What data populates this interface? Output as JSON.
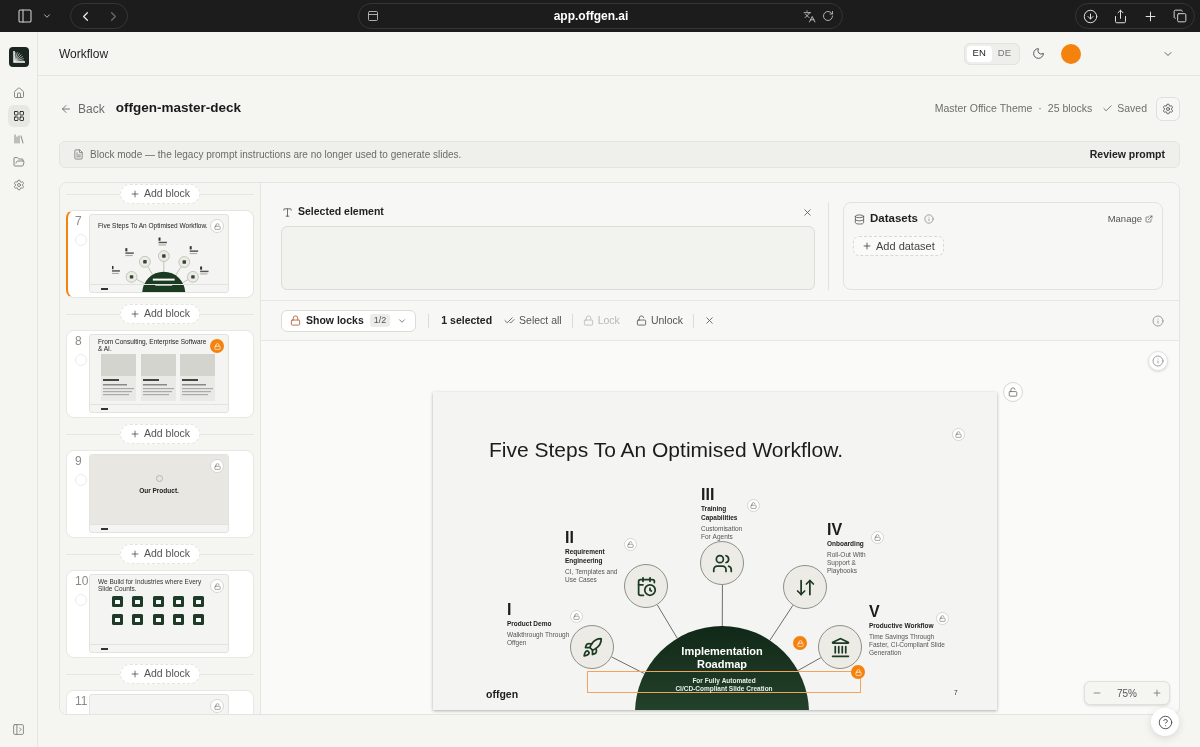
{
  "browser": {
    "url": "app.offgen.ai"
  },
  "rail": {
    "items": [
      {
        "selected": false
      },
      {
        "selected": true
      },
      {
        "selected": false
      },
      {
        "selected": false
      },
      {
        "selected": false
      }
    ]
  },
  "header": {
    "title": "Workflow",
    "languages": [
      {
        "label": "EN",
        "selected": true
      },
      {
        "label": "DE",
        "selected": false
      }
    ]
  },
  "deck": {
    "back": "Back",
    "name": "offgen-master-deck",
    "theme": "Master Office Theme",
    "separator": "·",
    "count": "25 blocks",
    "status": "Saved"
  },
  "notice": {
    "text": "Block mode — the legacy prompt instructions are no longer used to generate slides.",
    "action": "Review prompt"
  },
  "blocks": {
    "items": [
      {
        "kind": "add",
        "label": "Add block"
      },
      {
        "kind": "slide",
        "number": "7",
        "selected": true,
        "checked": false,
        "locked": false,
        "thumbnail": {
          "kind": "diagram",
          "title": "Five Steps To An Optimised Workflow."
        }
      },
      {
        "kind": "add",
        "label": "Add block"
      },
      {
        "kind": "slide",
        "number": "8",
        "selected": false,
        "checked": false,
        "locked": true,
        "thumbnail": {
          "kind": "team",
          "title": "From Consulting, Enterprise Software & AI."
        }
      },
      {
        "kind": "add",
        "label": "Add block"
      },
      {
        "kind": "slide",
        "number": "9",
        "selected": false,
        "checked": false,
        "locked": false,
        "thumbnail": {
          "kind": "section",
          "title": "Our Product."
        }
      },
      {
        "kind": "add",
        "label": "Add block"
      },
      {
        "kind": "slide",
        "number": "10",
        "selected": false,
        "checked": false,
        "locked": false,
        "thumbnail": {
          "kind": "icons",
          "title": "We Build for Industries where Every Slide Counts."
        }
      },
      {
        "kind": "add",
        "label": "Add block"
      },
      {
        "kind": "slide",
        "number": "11",
        "selected": false,
        "locked": false,
        "thumbnail": {
          "kind": "blank"
        }
      }
    ]
  },
  "inspector": {
    "selected_element": {
      "title": "Selected element"
    },
    "datasets": {
      "title": "Datasets",
      "manage": "Manage",
      "add": "Add dataset"
    }
  },
  "toolbar": {
    "show_locks": "Show locks",
    "lock_count": "1/2",
    "selection": "1 selected",
    "select_all": "Select all",
    "lock": {
      "label": "Lock",
      "disabled": true
    },
    "unlock": {
      "label": "Unlock",
      "disabled": false
    }
  },
  "slide": {
    "locked": false,
    "title": "Five Steps To An Optimised Workflow.",
    "title_locked": false,
    "steps": [
      {
        "numeral": "I",
        "title": "Product Demo",
        "description": "Walkthrough Through Offgen",
        "locked": false
      },
      {
        "numeral": "II",
        "title": "Requirement Engineering",
        "description": "CI, Templates and Use Cases",
        "locked": false
      },
      {
        "numeral": "III",
        "title": "Training Capabilities",
        "description": "Customisation For Agents",
        "locked": false
      },
      {
        "numeral": "IV",
        "title": "Onboarding",
        "description": "Roll-Out With Support & Playbooks",
        "locked": false
      },
      {
        "numeral": "V",
        "title": "Productive Workflow",
        "description": "Time Savings Through Faster, CI-Compliant Slide Generation",
        "locked": false
      }
    ],
    "center": {
      "title": "Implementation Roadmap",
      "locked": true,
      "subtitle": "For Fully Automated CI/CD-Compliant Slide Creation",
      "subtitle_locked": true,
      "subtitle_selected": true
    },
    "logo": "offgen",
    "page": "7"
  },
  "zoom": {
    "reading": "75%"
  }
}
